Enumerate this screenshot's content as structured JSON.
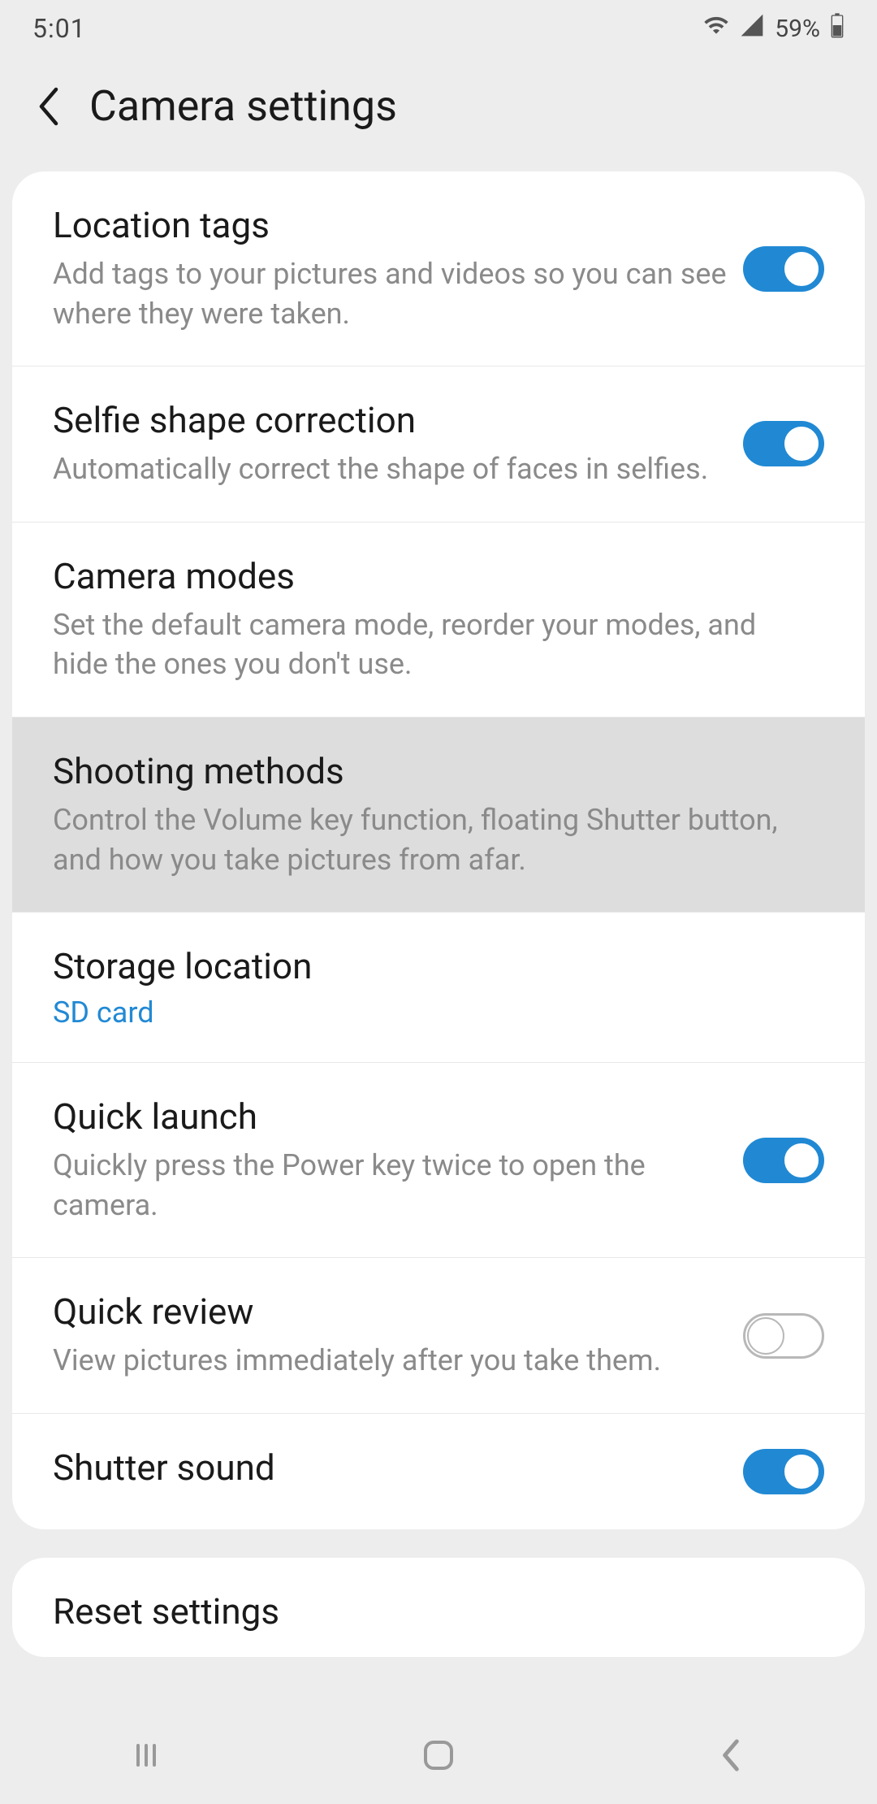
{
  "status": {
    "time": "5:01",
    "battery": "59%"
  },
  "header": {
    "title": "Camera settings"
  },
  "settings": {
    "location_tags": {
      "title": "Location tags",
      "subtitle": "Add tags to your pictures and videos so you can see where they were taken.",
      "on": true
    },
    "selfie_shape": {
      "title": "Selfie shape correction",
      "subtitle": "Automatically correct the shape of faces in selfies.",
      "on": true
    },
    "camera_modes": {
      "title": "Camera modes",
      "subtitle": "Set the default camera mode, reorder your modes, and hide the ones you don't use."
    },
    "shooting_methods": {
      "title": "Shooting methods",
      "subtitle": "Control the Volume key function, floating Shutter button, and how you take pictures from afar."
    },
    "storage": {
      "title": "Storage location",
      "value": "SD card"
    },
    "quick_launch": {
      "title": "Quick launch",
      "subtitle": "Quickly press the Power key twice to open the camera.",
      "on": true
    },
    "quick_review": {
      "title": "Quick review",
      "subtitle": "View pictures immediately after you take them.",
      "on": false
    },
    "shutter_sound": {
      "title": "Shutter sound",
      "on": true
    },
    "reset": {
      "title": "Reset settings"
    }
  }
}
